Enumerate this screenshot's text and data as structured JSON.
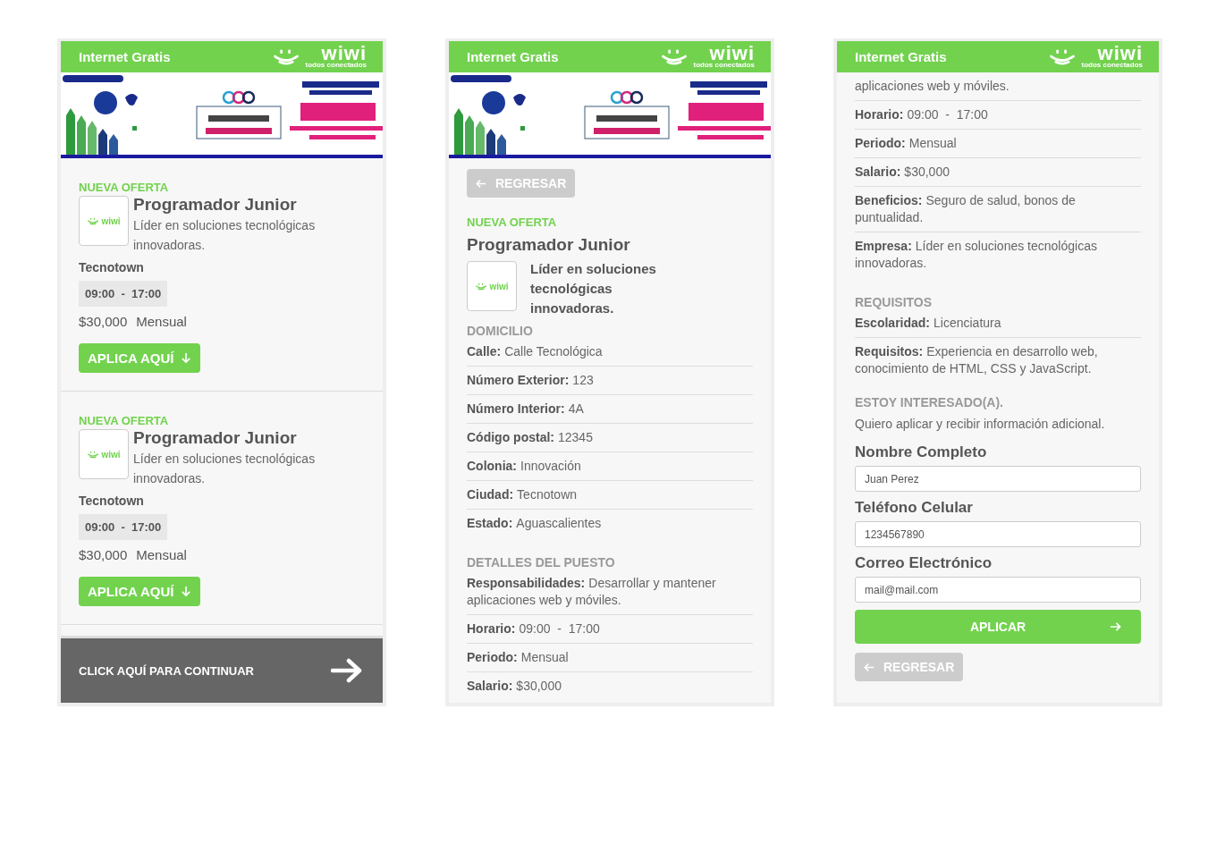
{
  "screens": [
    {
      "kind": "list",
      "header": {
        "title": "Internet Gratis",
        "brand": "wiwi",
        "tagline": "todos conectados"
      },
      "offers": [
        {
          "badge": "NUEVA OFERTA",
          "logo": "wiwi",
          "title": "Programador Junior",
          "description": "Líder en soluciones tecnológicas innovadoras.",
          "city": "Tecnotown",
          "hours": "09:00  -  17:00",
          "salary": "$30,000",
          "period": "Mensual",
          "button": "APLICA AQUÍ"
        },
        {
          "badge": "NUEVA OFERTA",
          "logo": "wiwi",
          "title": "Programador Junior",
          "description": "Líder en soluciones tecnológicas innovadoras.",
          "city": "Tecnotown",
          "hours": "09:00  -  17:00",
          "salary": "$30,000",
          "period": "Mensual",
          "button": "APLICA AQUÍ"
        }
      ],
      "footer": {
        "label": "CLICK AQUÍ PARA CONTINUAR"
      }
    },
    {
      "kind": "detail",
      "header": {
        "title": "Internet Gratis",
        "brand": "wiwi",
        "tagline": "todos conectados"
      },
      "back_button": "REGRESAR",
      "badge": "NUEVA OFERTA",
      "title": "Programador Junior",
      "logo": "wiwi",
      "description": "Líder en soluciones tecnológicas innovadoras.",
      "sections": [
        {
          "heading": "DOMICILIO",
          "fields": [
            {
              "label": "Calle:",
              "value": "Calle Tecnológica"
            },
            {
              "label": "Número Exterior:",
              "value": "123"
            },
            {
              "label": "Número Interior:",
              "value": "4A"
            },
            {
              "label": "Código postal:",
              "value": "12345"
            },
            {
              "label": "Colonia:",
              "value": "Innovación"
            },
            {
              "label": "Ciudad:",
              "value": "Tecnotown"
            },
            {
              "label": "Estado:",
              "value": "Aguascalientes"
            }
          ]
        },
        {
          "heading": "DETALLES DEL PUESTO",
          "fields": [
            {
              "label": "Responsabilidades:",
              "value": "Desarrollar y mantener aplicaciones web y móviles."
            },
            {
              "label": "Horario:",
              "value": "09:00  -  17:00"
            },
            {
              "label": "Periodo:",
              "value": "Mensual"
            },
            {
              "label": "Salario:",
              "value": "$30,000"
            }
          ]
        }
      ]
    },
    {
      "kind": "form",
      "header": {
        "title": "Internet Gratis",
        "brand": "wiwi",
        "tagline": "todos conectados"
      },
      "sections": [
        {
          "fields": [
            {
              "value": "aplicaciones web y móviles."
            },
            {
              "label": "Horario:",
              "value": "09:00  -  17:00"
            },
            {
              "label": "Periodo:",
              "value": "Mensual"
            },
            {
              "label": "Salario:",
              "value": "$30,000"
            },
            {
              "label": "Beneficios:",
              "value": "Seguro de salud, bonos de puntualidad."
            },
            {
              "label": "Empresa:",
              "value": "Líder en soluciones tecnológicas innovadoras."
            }
          ]
        },
        {
          "heading": "REQUISITOS",
          "fields": [
            {
              "label": "Escolaridad:",
              "value": "Licenciatura"
            },
            {
              "label": "Requisitos:",
              "value": "Experiencia en desarrollo web, conocimiento de HTML, CSS y JavaScript."
            }
          ]
        }
      ],
      "form": {
        "heading": "ESTOY INTERESADO(A).",
        "text": "Quiero aplicar y recibir información adicional.",
        "inputs": [
          {
            "label": "Nombre Completo",
            "value": "Juan Perez"
          },
          {
            "label": "Teléfono Celular",
            "value": "1234567890"
          },
          {
            "label": "Correo Electrónico",
            "value": "mail@mail.com"
          }
        ],
        "submit": "APLICAR",
        "back_button": "REGRESAR"
      }
    }
  ]
}
